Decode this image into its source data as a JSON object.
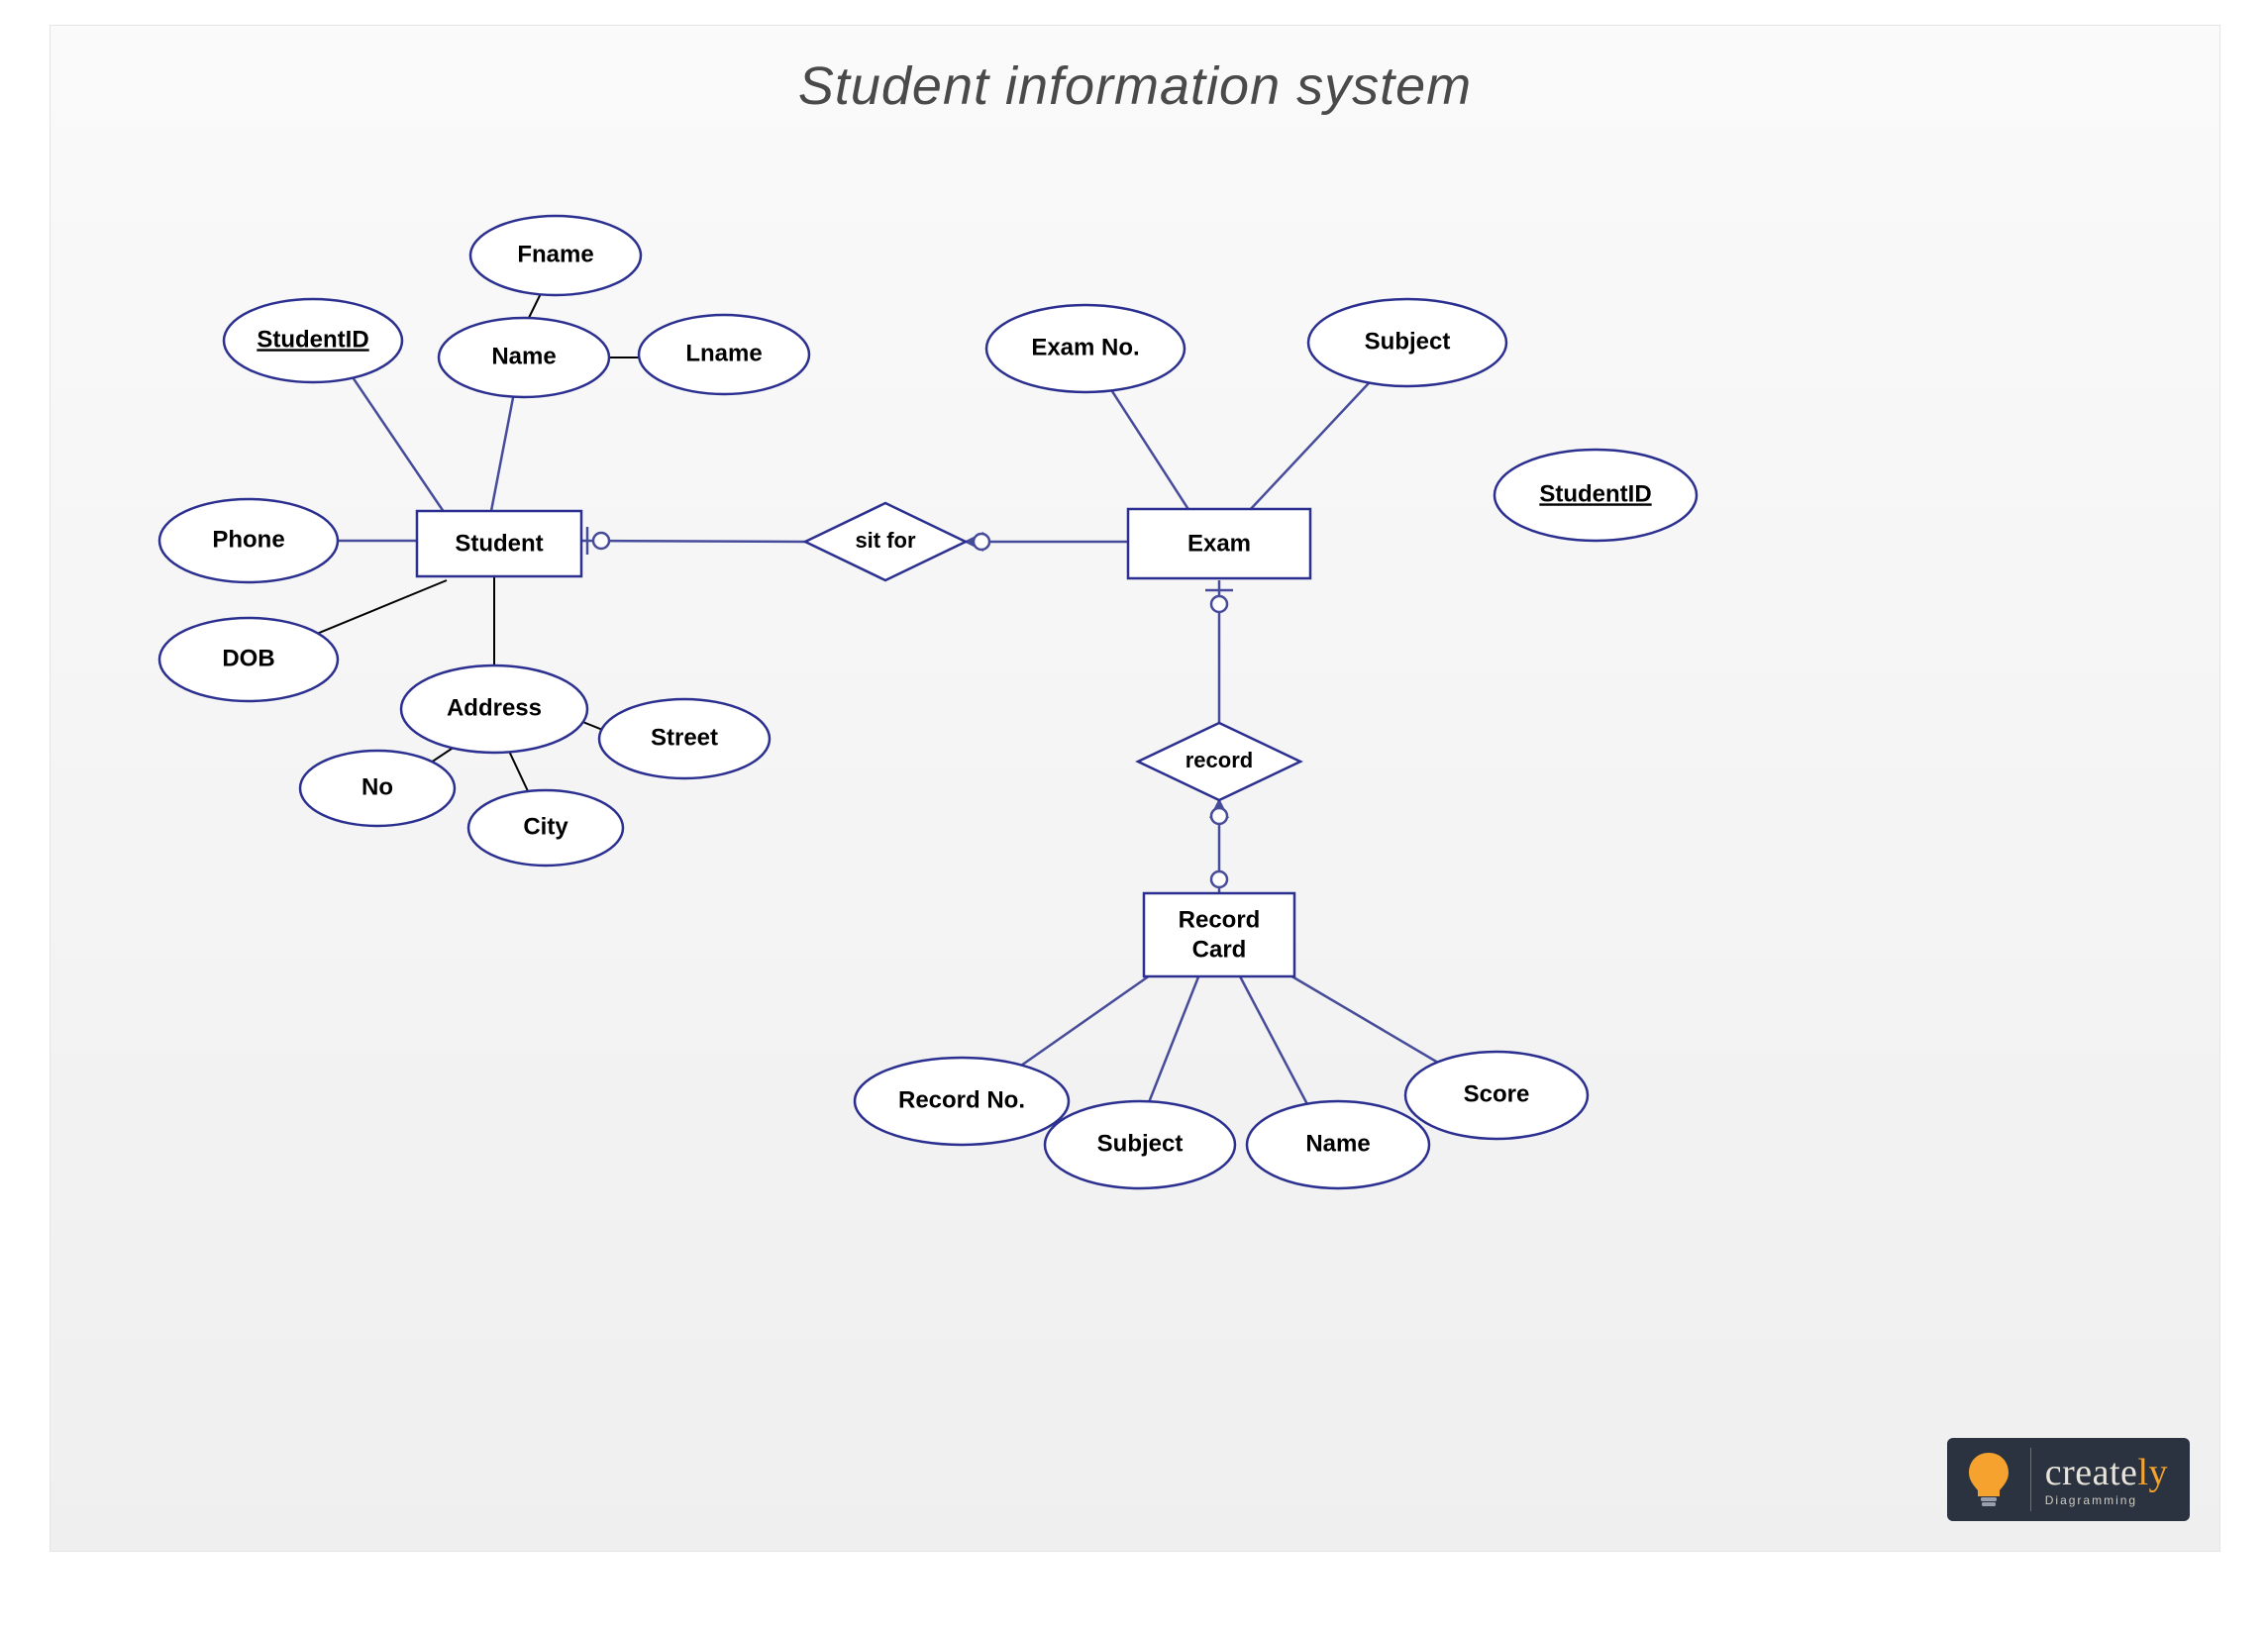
{
  "title": "Student information system",
  "entities": {
    "student": "Student",
    "exam": "Exam",
    "recordCard_line1": "Record",
    "recordCard_line2": "Card"
  },
  "relationships": {
    "sitFor": "sit for",
    "record": "record"
  },
  "attrs": {
    "student": {
      "studentId": "StudentID",
      "phone": "Phone",
      "dob": "DOB",
      "name": "Name",
      "fname": "Fname",
      "lname": "Lname",
      "address": "Address",
      "no": "No",
      "city": "City",
      "street": "Street"
    },
    "exam": {
      "examNo": "Exam No.",
      "subject": "Subject",
      "studentId": "StudentID"
    },
    "recordCard": {
      "recordNo": "Record No.",
      "subject": "Subject",
      "name": "Name",
      "score": "Score"
    }
  },
  "watermark": {
    "brand_a": "create",
    "brand_b": "ly",
    "tag": "Diagramming"
  }
}
